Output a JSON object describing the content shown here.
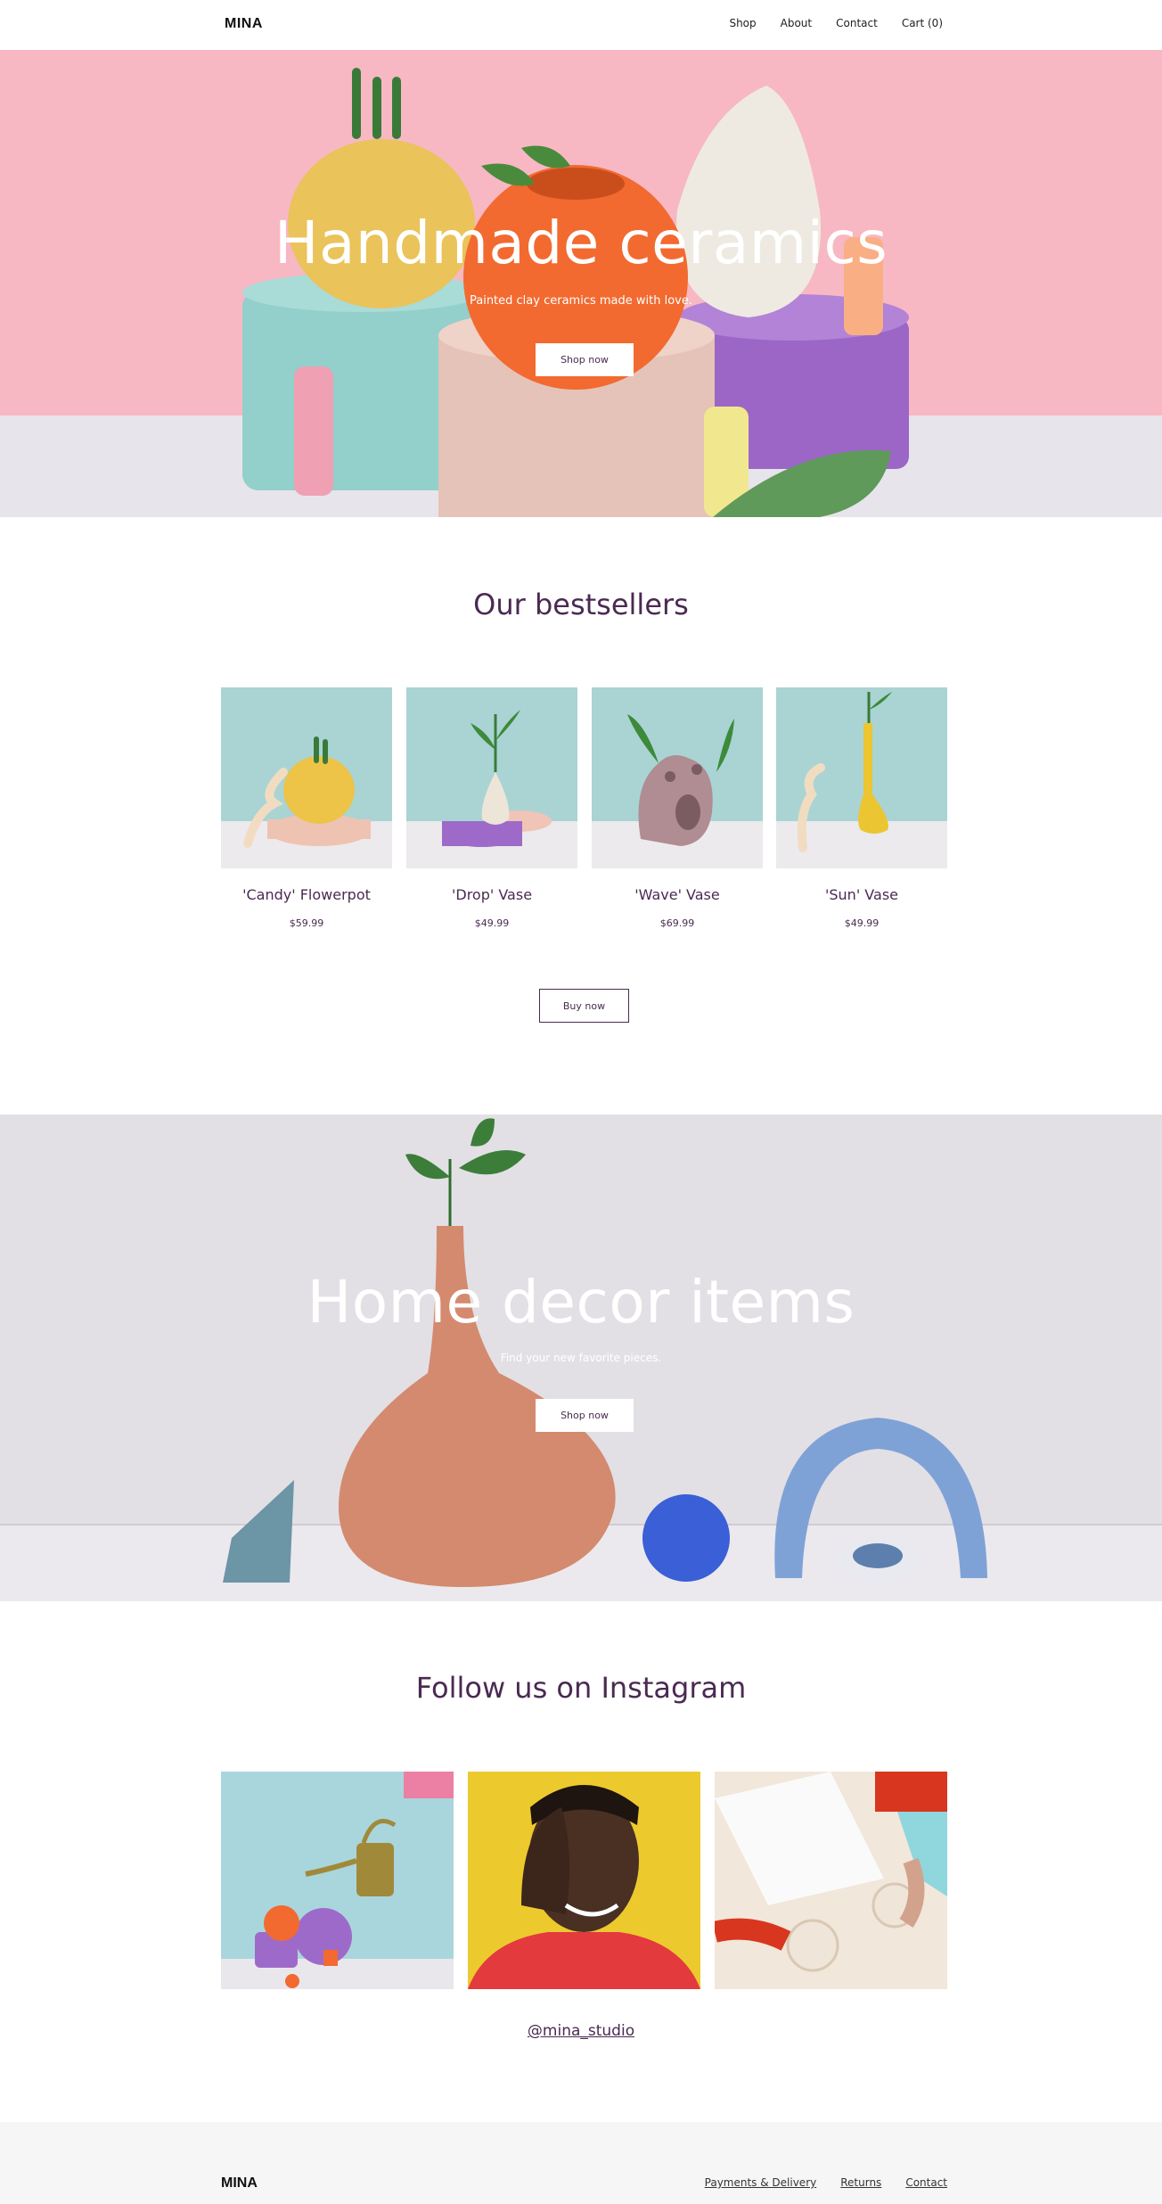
{
  "header": {
    "logo": "MINA",
    "nav": [
      "Shop",
      "About",
      "Contact",
      "Cart (0)"
    ]
  },
  "hero": {
    "title": "Handmade ceramics",
    "subtitle": "Painted clay ceramics made with love.",
    "button": "Shop now"
  },
  "bestsellers": {
    "title": "Our bestsellers",
    "products": [
      {
        "name": "'Candy' Flowerpot",
        "price": "$59.99"
      },
      {
        "name": "'Drop' Vase",
        "price": "$49.99"
      },
      {
        "name": "'Wave' Vase",
        "price": "$69.99"
      },
      {
        "name": "'Sun' Vase",
        "price": "$49.99"
      }
    ],
    "button": "Buy now"
  },
  "hero2": {
    "title": "Home decor items",
    "subtitle": "Find your new favorite pieces.",
    "button": "Shop now"
  },
  "instagram": {
    "title": "Follow us on Instagram",
    "handle": "@mina_studio"
  },
  "footer": {
    "logo": "MINA",
    "links": [
      "Payments & Delivery",
      "Returns",
      "Contact"
    ]
  },
  "colors": {
    "brand_text": "#4a2a52",
    "hero_bg": "#f7b8c3",
    "hero2_bg": "#e2e0e5",
    "footer_bg": "#f6f6f6"
  }
}
